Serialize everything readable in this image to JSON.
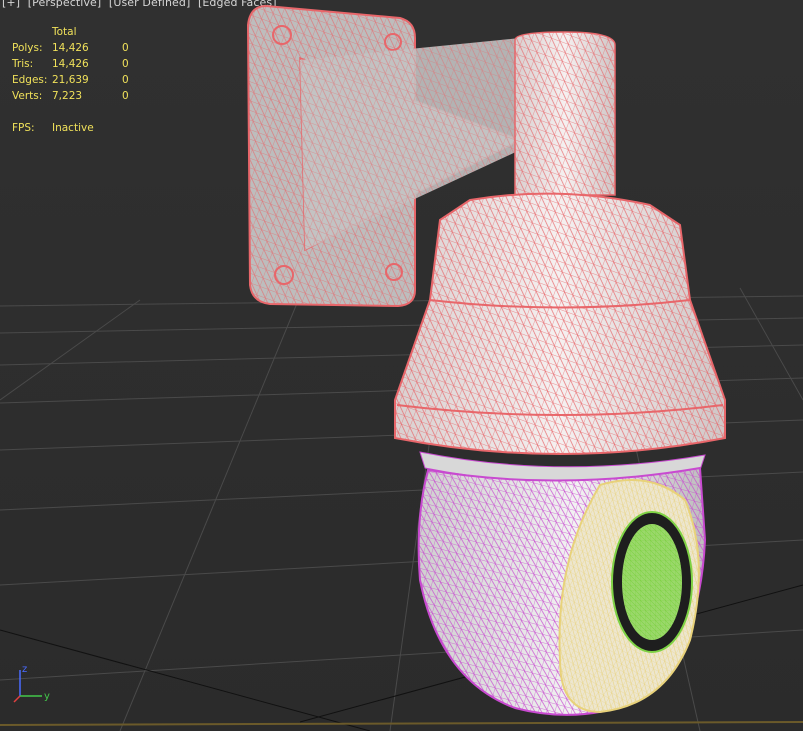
{
  "viewport": {
    "label_parts": [
      "[+]",
      "[Perspective]",
      "[User Defined]",
      "[Edged Faces]"
    ]
  },
  "stats": {
    "header": "Total",
    "rows": [
      {
        "label": "Polys:",
        "total": "14,426",
        "selected": "0"
      },
      {
        "label": "Tris:",
        "total": "14,426",
        "selected": "0"
      },
      {
        "label": "Edges:",
        "total": "21,639",
        "selected": "0"
      },
      {
        "label": "Verts:",
        "total": "7,223",
        "selected": "0"
      }
    ],
    "fps_label": "FPS:",
    "fps_value": "Inactive"
  },
  "gizmo": {
    "z": "z",
    "y": "y"
  },
  "colors": {
    "stats_text": "#f0e15a",
    "bracket_wire": "#e8666a",
    "housing_wire": "#e8666a",
    "dome_wire": "#c84ad0",
    "lens_ring_wire": "#e8d27a",
    "lens_wire": "#7ed244",
    "grid": "#4a4a4a"
  }
}
